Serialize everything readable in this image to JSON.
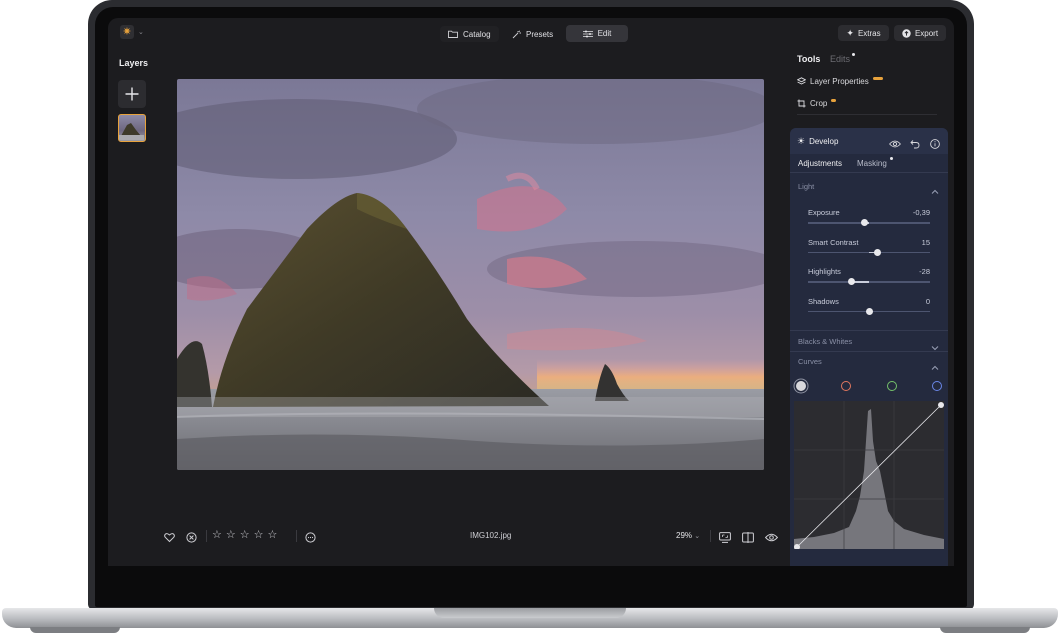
{
  "topbar": {
    "tabs": [
      {
        "label": "Catalog",
        "icon": "folder-icon"
      },
      {
        "label": "Presets",
        "icon": "magic-wand-icon"
      },
      {
        "label": "Edit",
        "icon": "sliders-icon"
      }
    ],
    "active_tab": "Edit",
    "extras_label": "Extras",
    "export_label": "Export"
  },
  "layers": {
    "title": "Layers"
  },
  "tools": {
    "tab_tools": "Tools",
    "tab_edits": "Edits",
    "layer_properties": "Layer Properties",
    "crop": "Crop"
  },
  "develop": {
    "title": "Develop",
    "tab_adjustments": "Adjustments",
    "tab_masking": "Masking",
    "section_light": "Light",
    "sliders": [
      {
        "label": "Exposure",
        "value": "-0,39",
        "position": 0.46
      },
      {
        "label": "Smart Contrast",
        "value": "15",
        "position": 0.57
      },
      {
        "label": "Highlights",
        "value": "-28",
        "position": 0.36
      },
      {
        "label": "Shadows",
        "value": "0",
        "position": 0.5
      }
    ],
    "section_blacks_whites": "Blacks & Whites",
    "section_curves": "Curves",
    "curve_channels": [
      "rgb",
      "red",
      "green",
      "blue"
    ],
    "curve_colors": {
      "rgb": "#d8d8dc",
      "red": "#e0775f",
      "green": "#74c06a",
      "blue": "#6a86e6"
    }
  },
  "bottombar": {
    "filename": "IMG102.jpg",
    "zoom": "29%",
    "star_count": 5
  },
  "colors": {
    "accent": "#e8a23c",
    "panel": "#242a3e"
  }
}
